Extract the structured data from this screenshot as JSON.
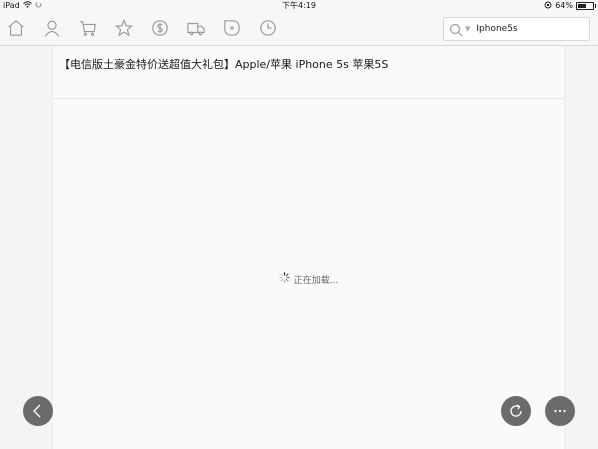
{
  "statusbar": {
    "device": "iPad",
    "time": "下午4:19",
    "battery": "64%",
    "battery_level": 0.64
  },
  "toolbar": {
    "icons": [
      "home-icon",
      "user-icon",
      "cart-icon",
      "star-icon",
      "coupon-icon",
      "truck-icon",
      "tag-icon",
      "clock-icon"
    ],
    "search_value": "Iphone5s"
  },
  "product": {
    "title": "【电信版土豪金特价送超值大礼包】Apple/苹果 iPhone 5s 苹果5S"
  },
  "loading": {
    "text": "正在加载..."
  }
}
